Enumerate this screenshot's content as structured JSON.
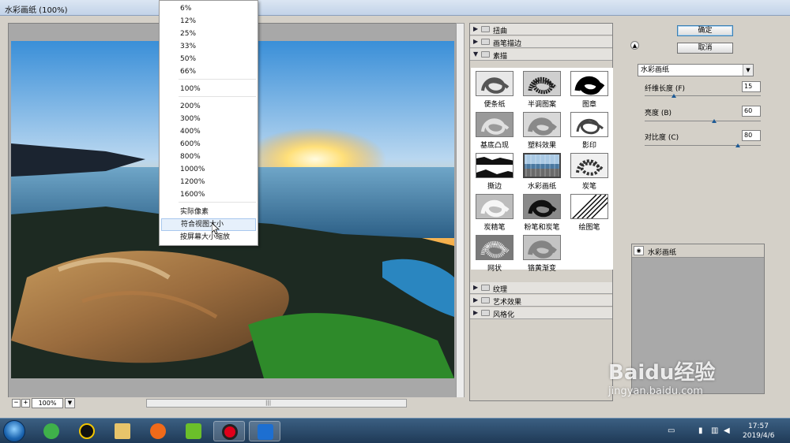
{
  "window": {
    "title": "水彩画纸 (100%)"
  },
  "zoom_menu": {
    "items": [
      "6%",
      "12%",
      "25%",
      "33%",
      "50%",
      "66%",
      "100%",
      "200%",
      "300%",
      "400%",
      "600%",
      "800%",
      "1000%",
      "1200%",
      "1600%",
      "实际像素",
      "符合视图大小",
      "按屏幕大小缩放"
    ],
    "hovered": "符合视图大小"
  },
  "preview": {
    "zoom_value": "100%",
    "zoom_minus": "−",
    "zoom_plus": "+"
  },
  "filter_categories": {
    "top": [
      "扭曲",
      "画笔描边",
      "素描"
    ],
    "bottom": [
      "纹理",
      "艺术效果",
      "风格化"
    ],
    "expanded": "素描"
  },
  "thumbnails": [
    "便条纸",
    "半调图案",
    "图章",
    "基底凸现",
    "塑料效果",
    "影印",
    "撕边",
    "水彩画纸",
    "炭笔",
    "炭精笔",
    "粉笔和炭笔",
    "绘图笔",
    "网状",
    "铬黄渐变"
  ],
  "selected_filter": "水彩画纸",
  "buttons": {
    "ok": "确定",
    "cancel": "取消"
  },
  "filter_select": {
    "value": "水彩画纸"
  },
  "params": [
    {
      "label": "纤维长度 (F)",
      "value": "15",
      "level": 0.25
    },
    {
      "label": "亮度 (B)",
      "value": "60",
      "level": 0.6
    },
    {
      "label": "对比度 (C)",
      "value": "80",
      "level": 0.8
    }
  ],
  "layer": {
    "name": "水彩画纸"
  },
  "taskbar": {
    "time": "17:57",
    "date": "2019/4/6"
  },
  "watermark": {
    "brand": "Baidu经验",
    "url": "jingyan.baidu.com"
  },
  "colors": {
    "accent": "#3c7fb1",
    "knob": "#1e5b96",
    "taskbar": "#2a4a6b"
  }
}
